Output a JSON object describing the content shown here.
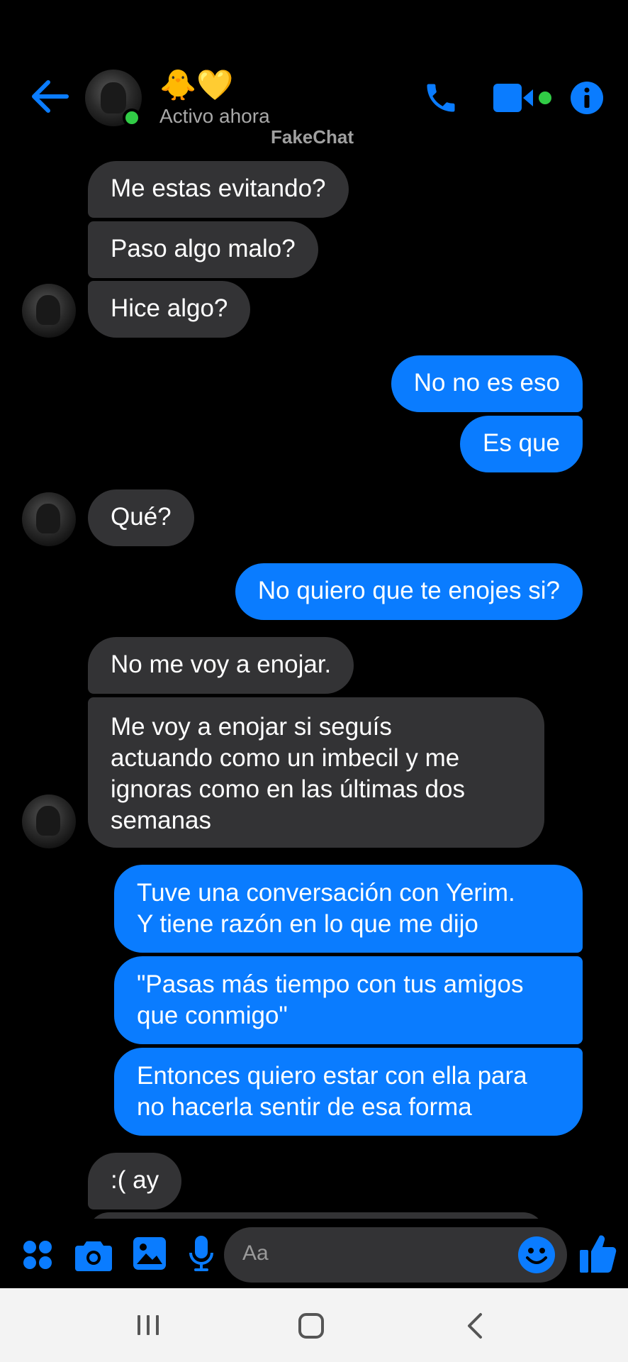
{
  "header": {
    "title": "🐥💛",
    "status": "Activo ahora",
    "watermark": "FakeChat",
    "icons": [
      "back-arrow-icon",
      "phone-icon",
      "video-camera-icon",
      "info-icon"
    ]
  },
  "messages": [
    {
      "side": "in",
      "text": "Me estas evitando?"
    },
    {
      "side": "in",
      "text": "Paso algo malo?"
    },
    {
      "side": "in",
      "text": "Hice algo?"
    },
    {
      "side": "out",
      "text": "No no es eso"
    },
    {
      "side": "out",
      "text": "Es que"
    },
    {
      "side": "in",
      "text": "Qué?"
    },
    {
      "side": "out",
      "text": "No quiero que te enojes si?"
    },
    {
      "side": "in",
      "text": "No me voy a enojar."
    },
    {
      "side": "in",
      "text": "Me voy a enojar si seguís\nactuando como un imbecil y me\nignoras como en las últimas dos\nsemanas"
    },
    {
      "side": "out",
      "text": "Tuve una conversación con Yerim.\nY tiene razón en lo que me dijo"
    },
    {
      "side": "out",
      "text": "\"Pasas más tiempo con tus amigos\nque conmigo\""
    },
    {
      "side": "out",
      "text": "Entonces quiero estar con ella para\nno hacerla sentir de esa forma"
    },
    {
      "side": "in",
      "text": ":( ay"
    }
  ],
  "composer": {
    "placeholder": "Aa",
    "icons": [
      "apps-icon",
      "camera-icon",
      "gallery-icon",
      "microphone-icon",
      "emoji-icon",
      "thumbs-up-icon"
    ]
  },
  "navbar": {
    "icons": [
      "recent-apps-icon",
      "home-icon",
      "back-icon"
    ]
  },
  "colors": {
    "accent": "#0a7cff",
    "incoming_bubble": "#333335",
    "online": "#31cc46"
  }
}
